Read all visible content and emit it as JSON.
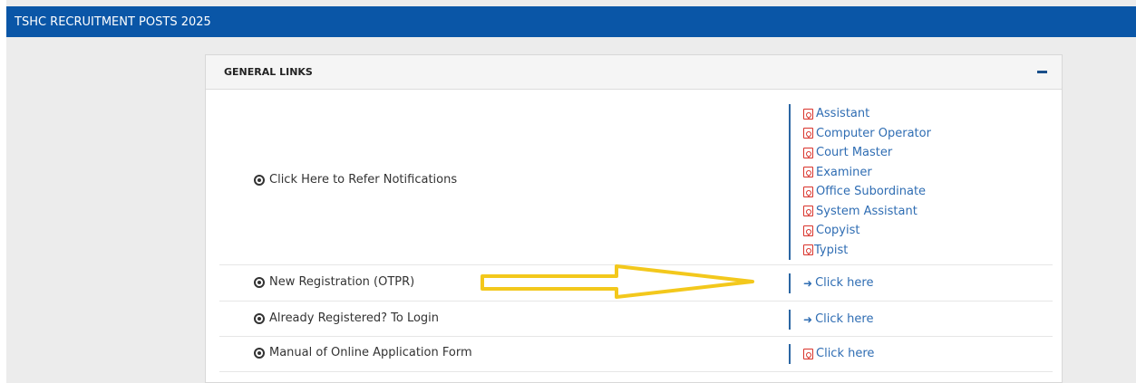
{
  "header": {
    "title": "TSHC RECRUITMENT POSTS 2025"
  },
  "panel": {
    "title": "GENERAL LINKS"
  },
  "rows": [
    {
      "label": "Click Here to Refer Notifications",
      "links": [
        {
          "text": "Assistant",
          "icon": "pdf-icon"
        },
        {
          "text": "Computer Operator",
          "icon": "pdf-icon"
        },
        {
          "text": "Court Master",
          "icon": "pdf-icon"
        },
        {
          "text": "Examiner",
          "icon": "pdf-icon"
        },
        {
          "text": "Office Subordinate",
          "icon": "pdf-icon"
        },
        {
          "text": "System Assistant",
          "icon": "pdf-icon"
        },
        {
          "text": "Copyist",
          "icon": "pdf-icon"
        },
        {
          "text": "Typist",
          "icon": "pdf-icon"
        }
      ]
    },
    {
      "label": "New Registration (OTPR)",
      "link": {
        "text": "Click here",
        "icon": "sign-in-icon"
      }
    },
    {
      "label": "Already Registered? To Login",
      "link": {
        "text": "Click here",
        "icon": "sign-in-icon"
      }
    },
    {
      "label": "Manual of Online Application Form",
      "link": {
        "text": "Click here",
        "icon": "pdf-icon"
      }
    }
  ],
  "colors": {
    "header_bg": "#0a56a7",
    "link": "#2f6db3",
    "pdf_red": "#d9332b",
    "arrow": "#f3c81c"
  }
}
